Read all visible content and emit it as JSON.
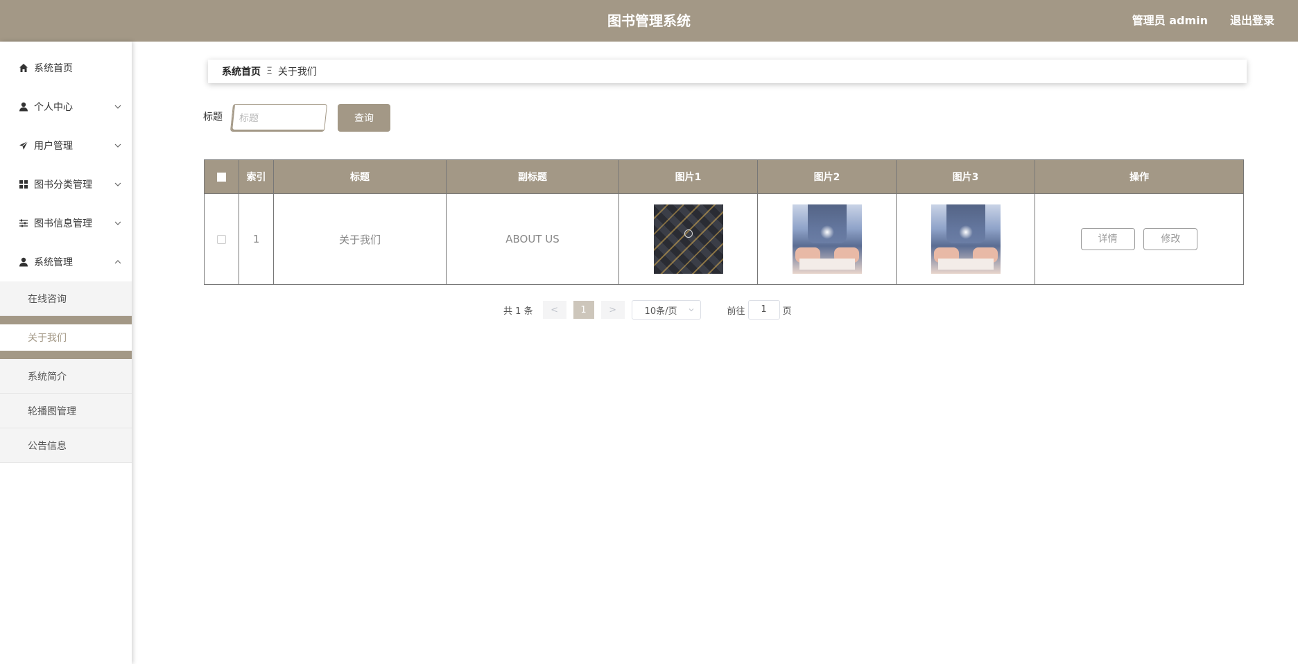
{
  "header": {
    "title": "图书管理系统",
    "user": "管理员 admin",
    "logout": "退出登录"
  },
  "sidebar": {
    "items": [
      {
        "label": "系统首页",
        "icon": "home-icon"
      },
      {
        "label": "个人中心",
        "icon": "user-icon"
      },
      {
        "label": "用户管理",
        "icon": "send-icon"
      },
      {
        "label": "图书分类管理",
        "icon": "grid-icon"
      },
      {
        "label": "图书信息管理",
        "icon": "sliders-icon"
      },
      {
        "label": "系统管理",
        "icon": "user-icon"
      }
    ],
    "sub_items": [
      "在线咨询",
      "关于我们",
      "系统简介",
      "轮播图管理",
      "公告信息"
    ]
  },
  "breadcrumb": {
    "home": "系统首页",
    "separator": "Ξ",
    "current": "关于我们"
  },
  "search": {
    "label": "标题",
    "placeholder": "标题",
    "button": "查询"
  },
  "table": {
    "headers": [
      "索引",
      "标题",
      "副标题",
      "图片1",
      "图片2",
      "图片3",
      "操作"
    ],
    "rows": [
      {
        "index": "1",
        "title": "关于我们",
        "subtitle": "ABOUT US",
        "detail": "详情",
        "edit": "修改"
      }
    ]
  },
  "pagination": {
    "total": "共 1 条",
    "prev": "<",
    "page": "1",
    "next": ">",
    "page_size": "10条/页",
    "goto_label": "前往",
    "goto_value": "1",
    "goto_suffix": "页"
  },
  "colors": {
    "accent": "#a39886"
  }
}
